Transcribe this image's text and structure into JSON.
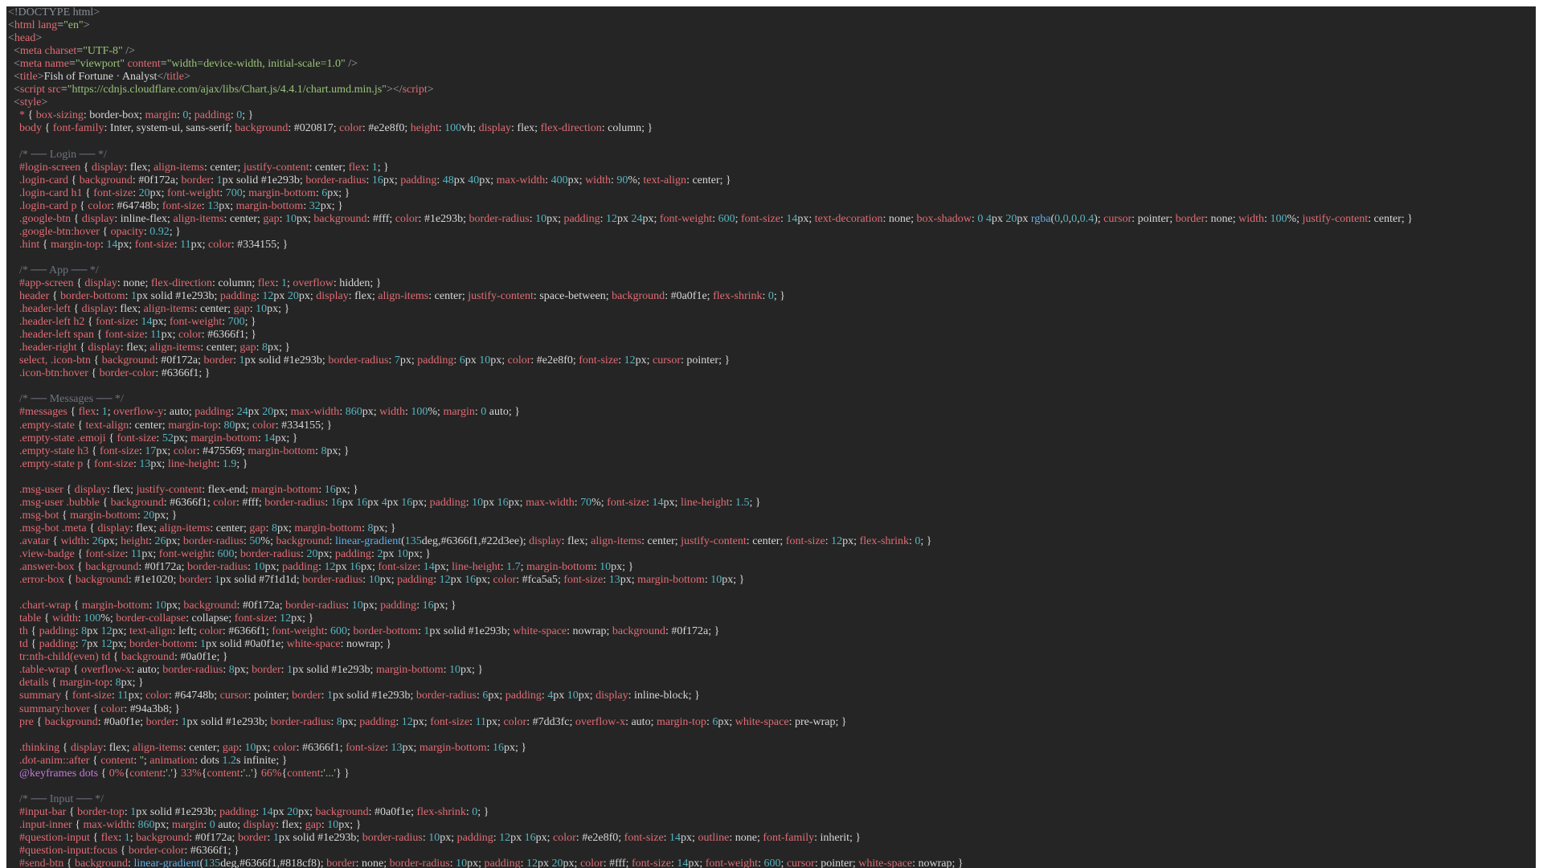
{
  "editor": {
    "lines": [
      "<!DOCTYPE html>",
      "<html lang=\"en\">",
      "<head>",
      "  <meta charset=\"UTF-8\" />",
      "  <meta name=\"viewport\" content=\"width=device-width, initial-scale=1.0\" />",
      "  <title>Fish of Fortune · Analyst</title>",
      "  <script src=\"https://cdnjs.cloudflare.com/ajax/libs/Chart.js/4.4.1/chart.umd.min.js\"></script>",
      "  <style>",
      "    * { box-sizing: border-box; margin: 0; padding: 0; }",
      "    body { font-family: Inter, system-ui, sans-serif; background: #020817; color: #e2e8f0; height: 100vh; display: flex; flex-direction: column; }",
      "",
      "    /* ── Login ── */",
      "    #login-screen { display: flex; align-items: center; justify-content: center; flex: 1; }",
      "    .login-card { background: #0f172a; border: 1px solid #1e293b; border-radius: 16px; padding: 48px 40px; max-width: 400px; width: 90%; text-align: center; }",
      "    .login-card h1 { font-size: 20px; font-weight: 700; margin-bottom: 6px; }",
      "    .login-card p { color: #64748b; font-size: 13px; margin-bottom: 32px; }",
      "    .google-btn { display: inline-flex; align-items: center; gap: 10px; background: #fff; color: #1e293b; border-radius: 10px; padding: 12px 24px; font-weight: 600; font-size: 14px; text-decoration: none; box-shadow: 0 4px 20px rgba(0,0,0,0.4); cursor: pointer; border: none; width: 100%; justify-content: center; }",
      "    .google-btn:hover { opacity: 0.92; }",
      "    .hint { margin-top: 14px; font-size: 11px; color: #334155; }",
      "",
      "    /* ── App ── */",
      "    #app-screen { display: none; flex-direction: column; flex: 1; overflow: hidden; }",
      "    header { border-bottom: 1px solid #1e293b; padding: 12px 20px; display: flex; align-items: center; justify-content: space-between; background: #0a0f1e; flex-shrink: 0; }",
      "    .header-left { display: flex; align-items: center; gap: 10px; }",
      "    .header-left h2 { font-size: 14px; font-weight: 700; }",
      "    .header-left span { font-size: 11px; color: #6366f1; }",
      "    .header-right { display: flex; align-items: center; gap: 8px; }",
      "    select, .icon-btn { background: #0f172a; border: 1px solid #1e293b; border-radius: 7px; padding: 6px 10px; color: #e2e8f0; font-size: 12px; cursor: pointer; }",
      "    .icon-btn:hover { border-color: #6366f1; }",
      "",
      "    /* ── Messages ── */",
      "    #messages { flex: 1; overflow-y: auto; padding: 24px 20px; max-width: 860px; width: 100%; margin: 0 auto; }",
      "    .empty-state { text-align: center; margin-top: 80px; color: #334155; }",
      "    .empty-state .emoji { font-size: 52px; margin-bottom: 14px; }",
      "    .empty-state h3 { font-size: 17px; color: #475569; margin-bottom: 8px; }",
      "    .empty-state p { font-size: 13px; line-height: 1.9; }",
      "",
      "    .msg-user { display: flex; justify-content: flex-end; margin-bottom: 16px; }",
      "    .msg-user .bubble { background: #6366f1; color: #fff; border-radius: 16px 16px 4px 16px; padding: 10px 16px; max-width: 70%; font-size: 14px; line-height: 1.5; }",
      "    .msg-bot { margin-bottom: 20px; }",
      "    .msg-bot .meta { display: flex; align-items: center; gap: 8px; margin-bottom: 8px; }",
      "    .avatar { width: 26px; height: 26px; border-radius: 50%; background: linear-gradient(135deg,#6366f1,#22d3ee); display: flex; align-items: center; justify-content: center; font-size: 12px; flex-shrink: 0; }",
      "    .view-badge { font-size: 11px; font-weight: 600; border-radius: 20px; padding: 2px 10px; }",
      "    .answer-box { background: #0f172a; border-radius: 10px; padding: 12px 16px; font-size: 14px; line-height: 1.7; margin-bottom: 10px; }",
      "    .error-box { background: #1e1020; border: 1px solid #7f1d1d; border-radius: 10px; padding: 12px 16px; color: #fca5a5; font-size: 13px; margin-bottom: 10px; }",
      "",
      "    .chart-wrap { margin-bottom: 10px; background: #0f172a; border-radius: 10px; padding: 16px; }",
      "    table { width: 100%; border-collapse: collapse; font-size: 12px; }",
      "    th { padding: 8px 12px; text-align: left; color: #6366f1; font-weight: 600; border-bottom: 1px solid #1e293b; white-space: nowrap; background: #0f172a; }",
      "    td { padding: 7px 12px; border-bottom: 1px solid #0a0f1e; white-space: nowrap; }",
      "    tr:nth-child(even) td { background: #0a0f1e; }",
      "    .table-wrap { overflow-x: auto; border-radius: 8px; border: 1px solid #1e293b; margin-bottom: 10px; }",
      "    details { margin-top: 8px; }",
      "    summary { font-size: 11px; color: #64748b; cursor: pointer; border: 1px solid #1e293b; border-radius: 6px; padding: 4px 10px; display: inline-block; }",
      "    summary:hover { color: #94a3b8; }",
      "    pre { background: #0a0f1e; border: 1px solid #1e293b; border-radius: 8px; padding: 12px; font-size: 11px; color: #7dd3fc; overflow-x: auto; margin-top: 6px; white-space: pre-wrap; }",
      "",
      "    .thinking { display: flex; align-items: center; gap: 10px; color: #6366f1; font-size: 13px; margin-bottom: 16px; }",
      "    .dot-anim::after { content: ''; animation: dots 1.2s infinite; }",
      "    @keyframes dots { 0%{content:'.'} 33%{content:'..'} 66%{content:'...'} }",
      "",
      "    /* ── Input ── */",
      "    #input-bar { border-top: 1px solid #1e293b; padding: 14px 20px; background: #0a0f1e; flex-shrink: 0; }",
      "    .input-inner { max-width: 860px; margin: 0 auto; display: flex; gap: 10px; }",
      "    #question-input { flex: 1; background: #0f172a; border: 1px solid #1e293b; border-radius: 10px; padding: 12px 16px; color: #e2e8f0; font-size: 14px; outline: none; font-family: inherit; }",
      "    #question-input:focus { border-color: #6366f1; }",
      "    #send-btn { background: linear-gradient(135deg,#6366f1,#818cf8); border: none; border-radius: 10px; padding: 12px 20px; color: #fff; font-size: 14px; font-weight: 600; cursor: pointer; white-space: nowrap; }"
    ]
  },
  "colors": {
    "background": "#252525",
    "tag": "#e06c75",
    "string": "#98c379",
    "number": "#56b6c2",
    "comment": "#6f7480",
    "keyword": "#c678dd",
    "function": "#61afef"
  }
}
